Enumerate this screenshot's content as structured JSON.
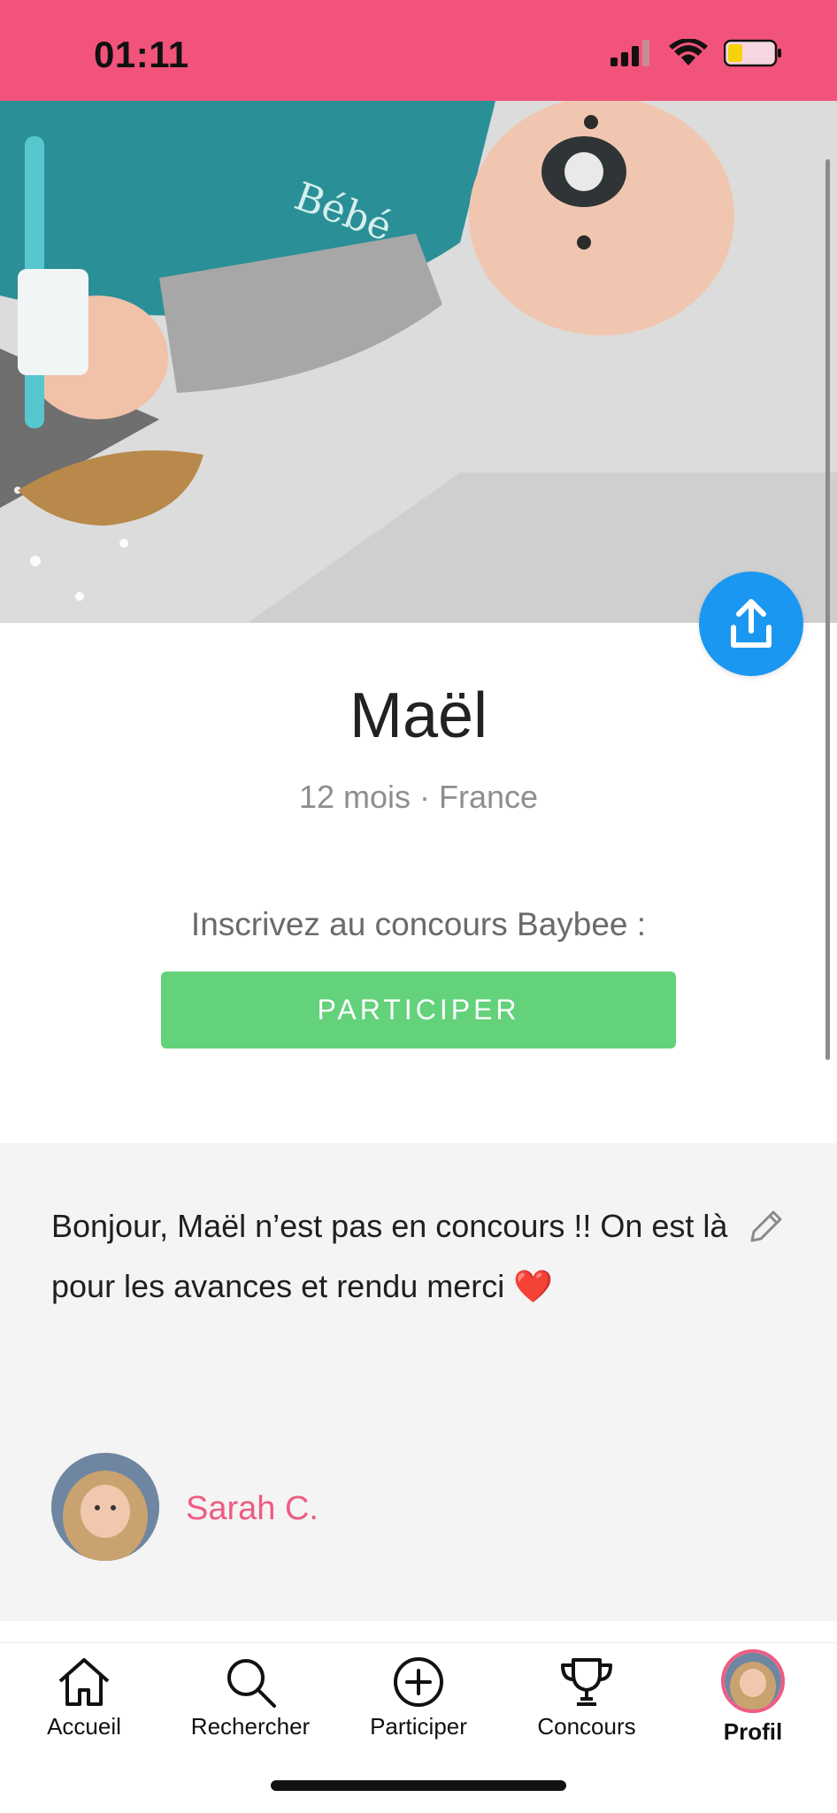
{
  "status_bar": {
    "time": "01:11",
    "background_color": "#f2537a",
    "icons": [
      "signal-icon",
      "wifi-icon",
      "battery-icon"
    ]
  },
  "hero": {
    "description_icon": "baby-photo",
    "share_icon": "share-upload-icon",
    "share_color": "#1a97f0"
  },
  "profile": {
    "name": "Maël",
    "meta": "12 mois · France"
  },
  "contest": {
    "prompt": "Inscrivez au concours Baybee :",
    "button_label": "PARTICIPER",
    "button_color": "#63d27b"
  },
  "bio": {
    "text": "Bonjour, Maël n’est pas en concours !! On est là pour les avances et rendu merci ❤️",
    "edit_icon": "pencil-icon"
  },
  "owner": {
    "name": "Sarah C.",
    "name_color": "#ee5c82"
  },
  "tabs": [
    {
      "label": "Accueil",
      "icon": "home-icon"
    },
    {
      "label": "Rechercher",
      "icon": "search-icon"
    },
    {
      "label": "Participer",
      "icon": "plus-circle-icon"
    },
    {
      "label": "Concours",
      "icon": "trophy-icon"
    },
    {
      "label": "Profil",
      "icon": "avatar-icon",
      "active": true
    }
  ]
}
